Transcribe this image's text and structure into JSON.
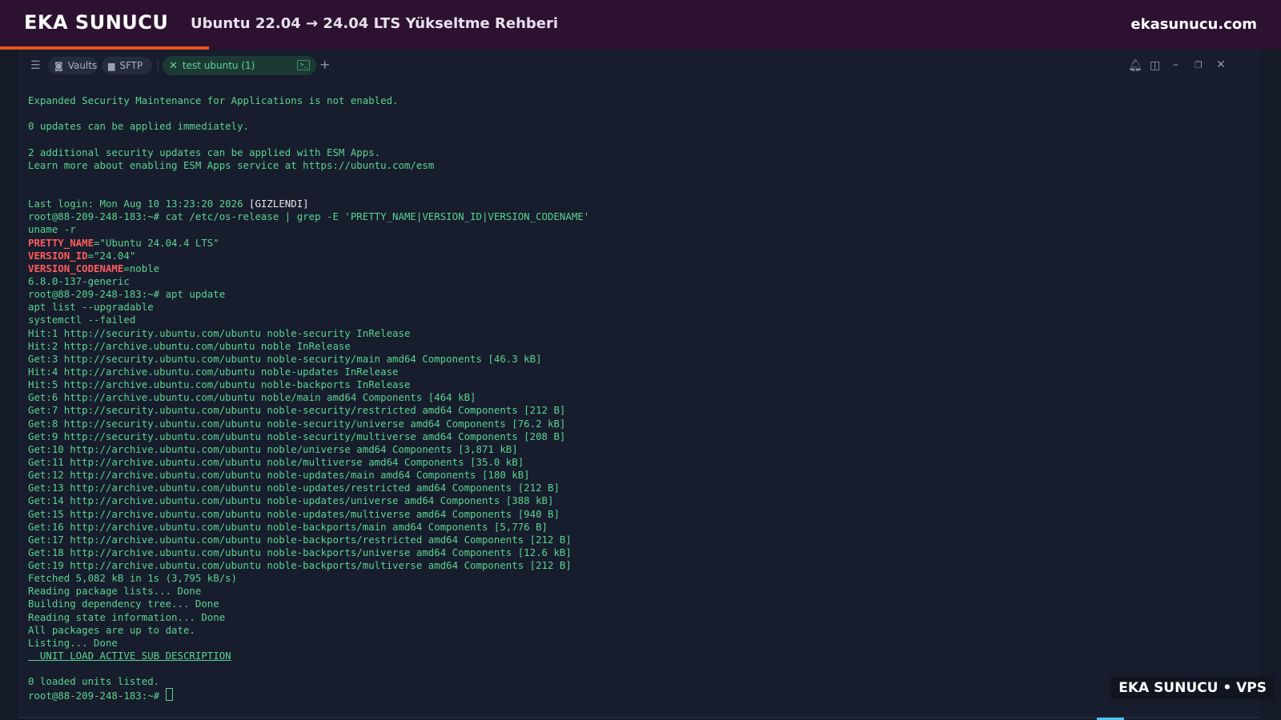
{
  "banner": {
    "brand": "EKA SUNUCU",
    "guide_title": "Ubuntu 22.04 → 24.04 LTS Yükseltme Rehberi",
    "site": "ekasunucu.com",
    "accent_color": "#e95420"
  },
  "tabbar": {
    "menu_icon": "hamburger-icon",
    "vaults_label": "Vaults",
    "sftp_label": "SFTP",
    "active_tab_label": "test ubuntu (1)",
    "add_tab": "+",
    "window_icons": [
      "bell-icon",
      "split-panel-icon",
      "minimize-icon",
      "restore-icon",
      "close-icon"
    ]
  },
  "terminal": {
    "lines": [
      "Expanded Security Maintenance for Applications is not enabled.",
      "",
      "0 updates can be applied immediately.",
      "",
      "2 additional security updates can be applied with ESM Apps.",
      "Learn more about enabling ESM Apps service at https://ubuntu.com/esm",
      "",
      "",
      "Last login: Mon Aug 10 13:23:20 2026 ",
      "root@88-209-248-183:~# cat /etc/os-release | grep -E 'PRETTY_NAME|VERSION_ID|VERSION_CODENAME'",
      "uname -r",
      "",
      "",
      "",
      "6.8.0-137-generic",
      "root@88-209-248-183:~# apt update",
      "apt list --upgradable",
      "systemctl --failed",
      "Hit:1 http://security.ubuntu.com/ubuntu noble-security InRelease",
      "Hit:2 http://archive.ubuntu.com/ubuntu noble InRelease",
      "Get:3 http://security.ubuntu.com/ubuntu noble-security/main amd64 Components [46.3 kB]",
      "Hit:4 http://archive.ubuntu.com/ubuntu noble-updates InRelease",
      "Hit:5 http://archive.ubuntu.com/ubuntu noble-backports InRelease",
      "Get:6 http://archive.ubuntu.com/ubuntu noble/main amd64 Components [464 kB]",
      "Get:7 http://security.ubuntu.com/ubuntu noble-security/restricted amd64 Components [212 B]",
      "Get:8 http://security.ubuntu.com/ubuntu noble-security/universe amd64 Components [76.2 kB]",
      "Get:9 http://security.ubuntu.com/ubuntu noble-security/multiverse amd64 Components [208 B]",
      "Get:10 http://archive.ubuntu.com/ubuntu noble/universe amd64 Components [3,871 kB]",
      "Get:11 http://archive.ubuntu.com/ubuntu noble/multiverse amd64 Components [35.0 kB]",
      "Get:12 http://archive.ubuntu.com/ubuntu noble-updates/main amd64 Components [180 kB]",
      "Get:13 http://archive.ubuntu.com/ubuntu noble-updates/restricted amd64 Components [212 B]",
      "Get:14 http://archive.ubuntu.com/ubuntu noble-updates/universe amd64 Components [388 kB]",
      "Get:15 http://archive.ubuntu.com/ubuntu noble-updates/multiverse amd64 Components [940 B]",
      "Get:16 http://archive.ubuntu.com/ubuntu noble-backports/main amd64 Components [5,776 B]",
      "Get:17 http://archive.ubuntu.com/ubuntu noble-backports/restricted amd64 Components [212 B]",
      "Get:18 http://archive.ubuntu.com/ubuntu noble-backports/universe amd64 Components [12.6 kB]",
      "Get:19 http://archive.ubuntu.com/ubuntu noble-backports/multiverse amd64 Components [212 B]",
      "Fetched 5,082 kB in 1s (3,795 kB/s)",
      "Reading package lists... Done",
      "Building dependency tree... Done",
      "Reading state information... Done",
      "All packages are up to date.",
      "Listing... Done",
      "",
      "",
      "0 loaded units listed.",
      "root@88-209-248-183:~# "
    ],
    "hidden_tag": "[GIZLENDI]",
    "os_release": [
      {
        "key": "PRETTY_NAME",
        "value": "=\"Ubuntu 24.04.4 LTS\""
      },
      {
        "key": "VERSION_ID",
        "value": "=\"24.04\""
      },
      {
        "key": "VERSION_CODENAME",
        "value": "=noble"
      }
    ],
    "unit_header": "  UNIT LOAD ACTIVE SUB DESCRIPTION"
  },
  "watermark": "EKA SUNUCU • VPS"
}
